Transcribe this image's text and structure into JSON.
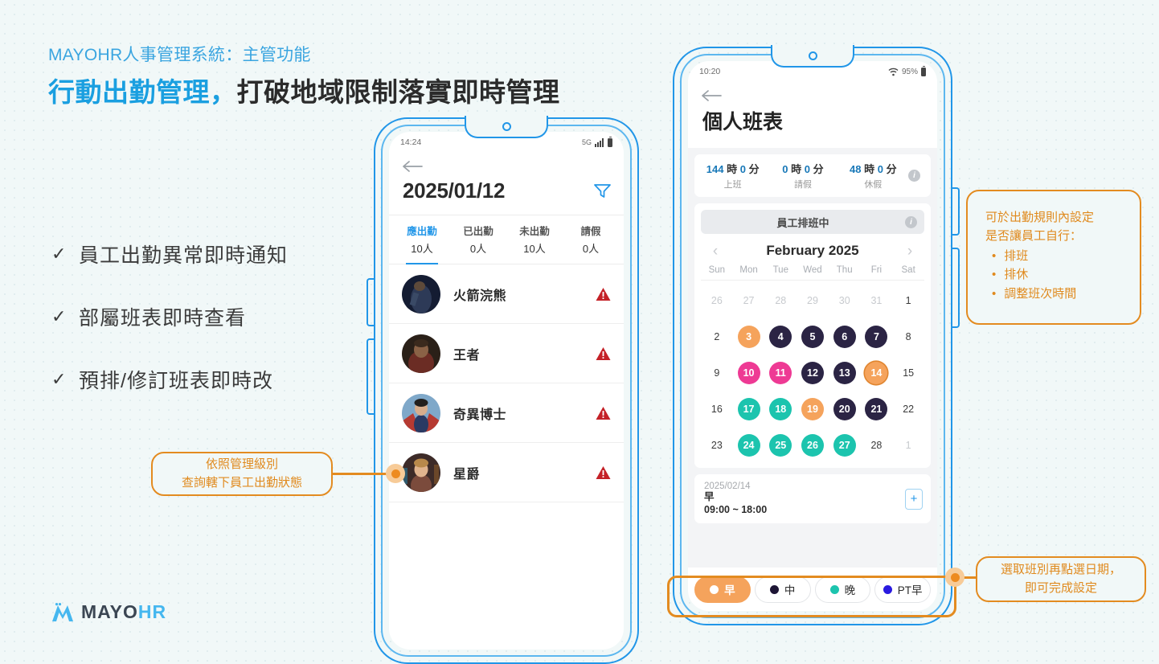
{
  "slide": {
    "eyebrow": "MAYOHR人事管理系統：主管功能",
    "headline_blue": "行動出勤管理，",
    "headline_dark": "打破地域限制落實即時管理",
    "bullets": [
      {
        "tick": "✓",
        "text": "員工出勤異常即時通知"
      },
      {
        "tick": "✓",
        "text": "部屬班表即時查看"
      },
      {
        "tick": "✓",
        "text": "預排/修訂班表即時改"
      }
    ],
    "logo": {
      "mayo": "MAYO",
      "hr": "HR"
    }
  },
  "phone1": {
    "status": {
      "time": "14:24",
      "network": "5G",
      "battery_icon": "battery-icon"
    },
    "date_title": "2025/01/12",
    "filter_icon": "filter-icon",
    "back_icon": "back-arrow-icon",
    "stats": [
      {
        "label": "應出勤",
        "value": "10人",
        "active": true
      },
      {
        "label": "已出勤",
        "value": "0人",
        "active": false
      },
      {
        "label": "未出勤",
        "value": "10人",
        "active": false
      },
      {
        "label": "請假",
        "value": "0人",
        "active": false
      }
    ],
    "employees": [
      {
        "name": "火箭浣熊",
        "status_icon": "warning-icon"
      },
      {
        "name": "王者",
        "status_icon": "warning-icon"
      },
      {
        "name": "奇異博士",
        "status_icon": "warning-icon"
      },
      {
        "name": "星爵",
        "status_icon": "warning-icon"
      }
    ]
  },
  "phone2": {
    "status": {
      "time": "10:20",
      "wifi_icon": "wifi-icon",
      "battery_pct": "95%",
      "battery_icon": "battery-icon"
    },
    "back_icon": "back-arrow-icon",
    "title": "個人班表",
    "hours": [
      {
        "value_num": "144",
        "unit1": "時",
        "value_min": "0",
        "unit2": "分",
        "label": "上班"
      },
      {
        "value_num": "0",
        "unit1": "時",
        "value_min": "0",
        "unit2": "分",
        "label": "請假"
      },
      {
        "value_num": "48",
        "unit1": "時",
        "value_min": "0",
        "unit2": "分",
        "label": "休假"
      }
    ],
    "info_icon": "info-icon",
    "schedule_banner": "員工排班中",
    "month_label": "February 2025",
    "prev_icon": "chevron-left-icon",
    "next_icon": "chevron-right-icon",
    "dow": [
      "Sun",
      "Mon",
      "Tue",
      "Wed",
      "Thu",
      "Fri",
      "Sat"
    ],
    "days": [
      {
        "n": "26",
        "s": "muted"
      },
      {
        "n": "27",
        "s": "muted"
      },
      {
        "n": "28",
        "s": "muted"
      },
      {
        "n": "29",
        "s": "muted"
      },
      {
        "n": "30",
        "s": "muted"
      },
      {
        "n": "31",
        "s": "muted"
      },
      {
        "n": "1",
        "s": "plain"
      },
      {
        "n": "2",
        "s": "plain"
      },
      {
        "n": "3",
        "s": "orange"
      },
      {
        "n": "4",
        "s": "navy"
      },
      {
        "n": "5",
        "s": "navy"
      },
      {
        "n": "6",
        "s": "navy"
      },
      {
        "n": "7",
        "s": "navy"
      },
      {
        "n": "8",
        "s": "plain"
      },
      {
        "n": "9",
        "s": "plain"
      },
      {
        "n": "10",
        "s": "pink"
      },
      {
        "n": "11",
        "s": "pink"
      },
      {
        "n": "12",
        "s": "navy"
      },
      {
        "n": "13",
        "s": "navy"
      },
      {
        "n": "14",
        "s": "orange-ring"
      },
      {
        "n": "15",
        "s": "plain"
      },
      {
        "n": "16",
        "s": "plain"
      },
      {
        "n": "17",
        "s": "teal"
      },
      {
        "n": "18",
        "s": "teal"
      },
      {
        "n": "19",
        "s": "orange"
      },
      {
        "n": "20",
        "s": "navy"
      },
      {
        "n": "21",
        "s": "navy"
      },
      {
        "n": "22",
        "s": "plain"
      },
      {
        "n": "23",
        "s": "plain"
      },
      {
        "n": "24",
        "s": "teal"
      },
      {
        "n": "25",
        "s": "teal"
      },
      {
        "n": "26",
        "s": "teal"
      },
      {
        "n": "27",
        "s": "teal"
      },
      {
        "n": "28",
        "s": "plain"
      },
      {
        "n": "1",
        "s": "muted"
      }
    ],
    "detail": {
      "date": "2025/02/14",
      "shift_name": "早",
      "time_range": "09:00 ~ 18:00",
      "add_icon": "add-shift-icon"
    },
    "shift_chips": [
      {
        "label": "早",
        "color": "#ffffff",
        "selected": true
      },
      {
        "label": "中",
        "color": "#1d1535",
        "selected": false
      },
      {
        "label": "晚",
        "color": "#1cc4ae",
        "selected": false
      },
      {
        "label": "PT早",
        "color": "#2a1ae0",
        "selected": false
      }
    ]
  },
  "callouts": {
    "left": {
      "line1": "依照管理級別",
      "line2": "查詢轄下員工出勤狀態"
    },
    "right_top": {
      "line1": "可於出勤規則內設定",
      "line2": "是否讓員工自行：",
      "items": [
        "排班",
        "排休",
        "調整班次時間"
      ]
    },
    "right_bottom": {
      "line1": "選取班別再點選日期，",
      "line2": "即可完成設定"
    }
  },
  "colors": {
    "brand_blue": "#2196e8",
    "accent_orange": "#E38B20",
    "calendar_orange": "#F5A35C",
    "calendar_navy": "#2B2444",
    "calendar_pink": "#EE3A94",
    "calendar_teal": "#1CC4AE",
    "warning_red": "#C42127"
  }
}
